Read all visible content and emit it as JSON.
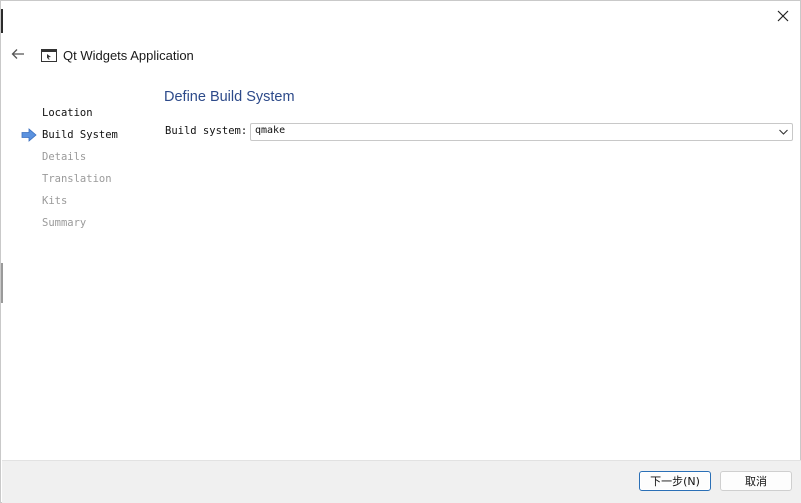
{
  "window": {
    "title": "Qt Widgets Application"
  },
  "icons": {
    "close": "close-icon",
    "back": "back-arrow-icon",
    "app": "qt-application-icon",
    "current_step": "current-step-arrow-icon",
    "dropdown": "chevron-down-icon"
  },
  "steps": [
    {
      "label": "Location",
      "state": "done"
    },
    {
      "label": "Build System",
      "state": "current"
    },
    {
      "label": "Details",
      "state": "pending"
    },
    {
      "label": "Translation",
      "state": "pending"
    },
    {
      "label": "Kits",
      "state": "pending"
    },
    {
      "label": "Summary",
      "state": "pending"
    }
  ],
  "page": {
    "heading": "Define Build System",
    "build_system_label": "Build system:",
    "build_system_value": "qmake"
  },
  "footer": {
    "next_label": "下一步(N)",
    "cancel_label": "取消"
  },
  "colors": {
    "heading": "#2d4a8a",
    "accent": "#2a6fb6",
    "step_arrow": "#4f86d6",
    "pending_step": "#9a9a9a"
  }
}
